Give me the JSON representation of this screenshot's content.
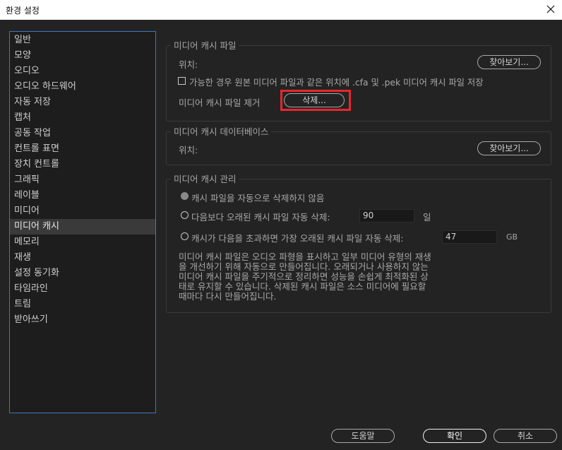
{
  "window": {
    "title": "환경 설정",
    "close_icon": "close-icon"
  },
  "sidebar": {
    "items": [
      {
        "label": "일반"
      },
      {
        "label": "모양"
      },
      {
        "label": "오디오"
      },
      {
        "label": "오디오 하드웨어"
      },
      {
        "label": "자동 저장"
      },
      {
        "label": "캡처"
      },
      {
        "label": "공동 작업"
      },
      {
        "label": "컨트롤 표면"
      },
      {
        "label": "장치 컨트롤"
      },
      {
        "label": "그래픽"
      },
      {
        "label": "레이블"
      },
      {
        "label": "미디어"
      },
      {
        "label": "미디어 캐시",
        "selected": true
      },
      {
        "label": "메모리"
      },
      {
        "label": "재생"
      },
      {
        "label": "설정 동기화"
      },
      {
        "label": "타임라인"
      },
      {
        "label": "트림"
      },
      {
        "label": "받아쓰기"
      }
    ]
  },
  "cache_files": {
    "legend": "미디어 캐시 파일",
    "location_label": "위치:",
    "browse_label": "찾아보기...",
    "save_next_checkbox": "가능한 경우 원본 미디어 파일과 같은 위치에 .cfa 및 .pek 미디어 캐시 파일 저장",
    "save_next_checked": false,
    "remove_label": "미디어 캐시 파일 제거",
    "delete_label": "삭제..."
  },
  "cache_database": {
    "legend": "미디어 캐시 데이터베이스",
    "location_label": "위치:",
    "browse_label": "찾아보기..."
  },
  "cache_management": {
    "legend": "미디어 캐시 관리",
    "option_never": "캐시 파일을 자동으로 삭제하지 않음",
    "option_older": "다음보다 오래된 캐시 파일 자동 삭제:",
    "older_value": "90",
    "older_unit": "일",
    "option_exceeds": "캐시가 다음을 초과하면 가장 오래된 캐시 파일 자동 삭제:",
    "exceeds_value": "47",
    "exceeds_unit": "GB",
    "selected_option": "never",
    "description_lines": [
      "미디어 캐시 파일은 오디오 파형을 표시하고 일부 미디어 유형의 재생",
      "을 개선하기 위해 자동으로 만들어집니다. 오래되거나 사용하지 않는",
      "미디어 캐시 파일을 주기적으로 정리하면 성능을 손쉽게 최적화된 상",
      "태로 유지할 수 있습니다. 삭제된 캐시 파일은 소스 미디어에 필요할",
      "때마다 다시 만들어집니다."
    ]
  },
  "footer": {
    "help_label": "도움말",
    "ok_label": "확인",
    "cancel_label": "취소"
  },
  "colors": {
    "background": "#232323",
    "selection_border": "#3d78c0",
    "highlight_box": "#e8262b"
  }
}
